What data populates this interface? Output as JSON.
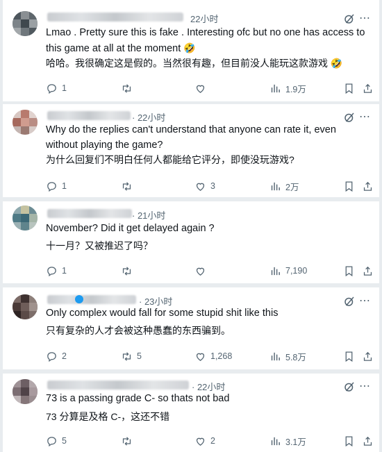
{
  "posts": [
    {
      "time": "22小时",
      "text": "Lmao . Pretty sure this is fake . Interesting ofc but no one has access to this game at all at the moment",
      "text_emoji": "🤣",
      "translation": "哈哈。我很确定这是假的。当然很有趣，但目前没人能玩这款游戏",
      "translation_emoji": "🤣",
      "replies": "1",
      "reposts": "",
      "likes": "",
      "views": "1.9万"
    },
    {
      "time": "· 22小时",
      "text": "Why do the replies can't understand that anyone can rate it, even without playing the game?",
      "translation": "为什么回复们不明白任何人都能给它评分，即使没玩游戏?",
      "replies": "1",
      "reposts": "",
      "likes": "3",
      "views": "2万"
    },
    {
      "time": "· 21小时",
      "text": "November? Did it get delayed again ?",
      "translation": "十一月？又被推迟了吗？",
      "replies": "1",
      "reposts": "",
      "likes": "",
      "views": "7,190"
    },
    {
      "time": "· 23小时",
      "text": "Only complex would fall for some stupid shit like this",
      "translation": "只有复杂的人才会被这种愚蠢的东西骗到。",
      "replies": "2",
      "reposts": "5",
      "likes": "1,268",
      "views": "5.8万"
    },
    {
      "time": "· 22小时",
      "text": "73 is a passing grade C-  so thats not bad",
      "translation": "73 分算是及格 C-，这还不错",
      "replies": "5",
      "reposts": "",
      "likes": "2",
      "views": "3.1万"
    }
  ],
  "colors": {
    "icon": "#536471",
    "verified": "#1d9bf0",
    "background": "#ffffff"
  }
}
